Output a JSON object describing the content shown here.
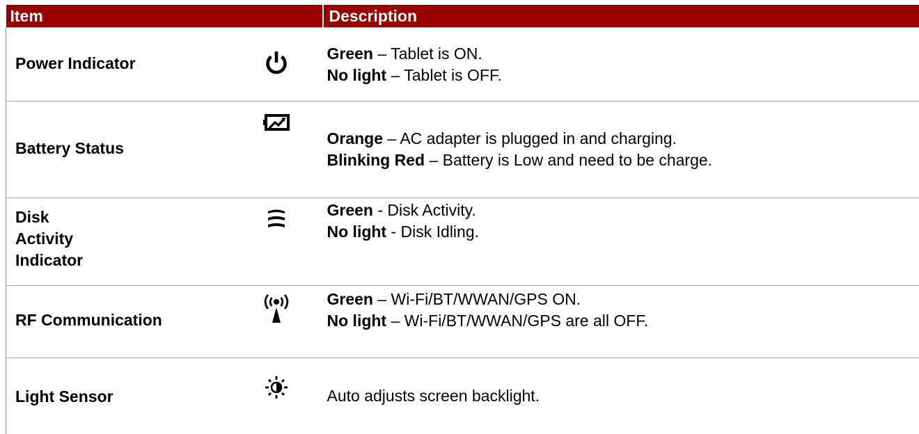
{
  "table": {
    "headers": {
      "item": "Item",
      "description": "Description"
    },
    "rows": [
      {
        "item": "Power Indicator",
        "icon": "power-icon",
        "lines": [
          {
            "label": "Green",
            "text": " – Tablet is ON."
          },
          {
            "label": "No light",
            "text": " – Tablet is OFF."
          }
        ]
      },
      {
        "item": "Battery Status",
        "icon": "battery-charging-icon",
        "lines": [
          {
            "label": "Orange",
            "text": " – AC adapter is plugged in and charging."
          },
          {
            "label": "Blinking Red",
            "text": " – Battery is Low and need to be charge."
          }
        ]
      },
      {
        "item_lines": [
          "Disk",
          "Activity",
          "Indicator"
        ],
        "icon": "disk-stack-icon",
        "lines": [
          {
            "label": "Green",
            "text": " - Disk Activity."
          },
          {
            "label": "No light",
            "text": " - Disk Idling."
          }
        ]
      },
      {
        "item": "RF Communication",
        "icon": "rf-antenna-icon",
        "lines": [
          {
            "label": "Green",
            "text": " – Wi-Fi/BT/WWAN/GPS ON."
          },
          {
            "label": "No light",
            "text": " – Wi-Fi/BT/WWAN/GPS are all OFF."
          }
        ]
      },
      {
        "item": "Light Sensor",
        "icon": "light-sensor-icon",
        "lines": [
          {
            "text": "Auto adjusts screen backlight."
          }
        ]
      }
    ]
  },
  "colors": {
    "header_bg": "#990000",
    "header_text": "#ffffff",
    "row_border": "#a6a6a6"
  }
}
